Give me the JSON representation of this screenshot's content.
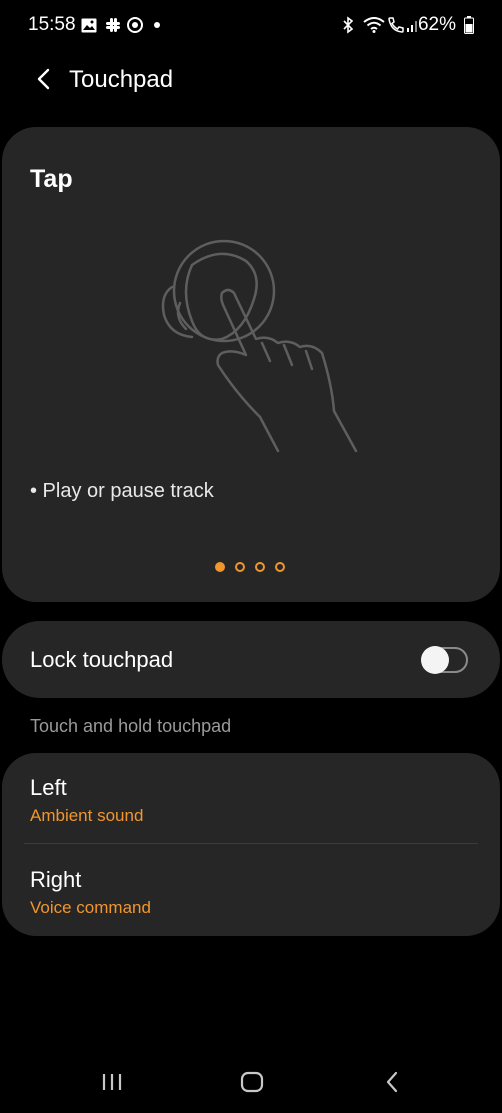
{
  "status_bar": {
    "time": "15:58",
    "battery": "62%",
    "left_icons": [
      "image-icon",
      "slack-icon",
      "media-icon",
      "dot-icon"
    ],
    "right_icons": [
      "bluetooth-icon",
      "wifi-icon",
      "call-icon",
      "signal-icon",
      "battery-icon"
    ]
  },
  "header": {
    "title": "Touchpad",
    "back_icon": "back-arrow-icon"
  },
  "tutorial": {
    "title": "Tap",
    "description": "• Play or pause track",
    "page_count": 4,
    "active_page": 1,
    "illustration_icon": "earbud-tap-illustration"
  },
  "lock_touchpad": {
    "label": "Lock touchpad",
    "enabled": false
  },
  "touch_and_hold": {
    "section_label": "Touch and hold touchpad",
    "items": [
      {
        "title": "Left",
        "value": "Ambient sound"
      },
      {
        "title": "Right",
        "value": "Voice command"
      }
    ]
  },
  "nav_bar": {
    "recents_icon": "recents-icon",
    "home_icon": "home-icon",
    "back_icon": "nav-back-icon"
  },
  "colors": {
    "background": "#000000",
    "card": "#262626",
    "accent": "#f0962e",
    "secondary_text": "#9a9a9a"
  }
}
